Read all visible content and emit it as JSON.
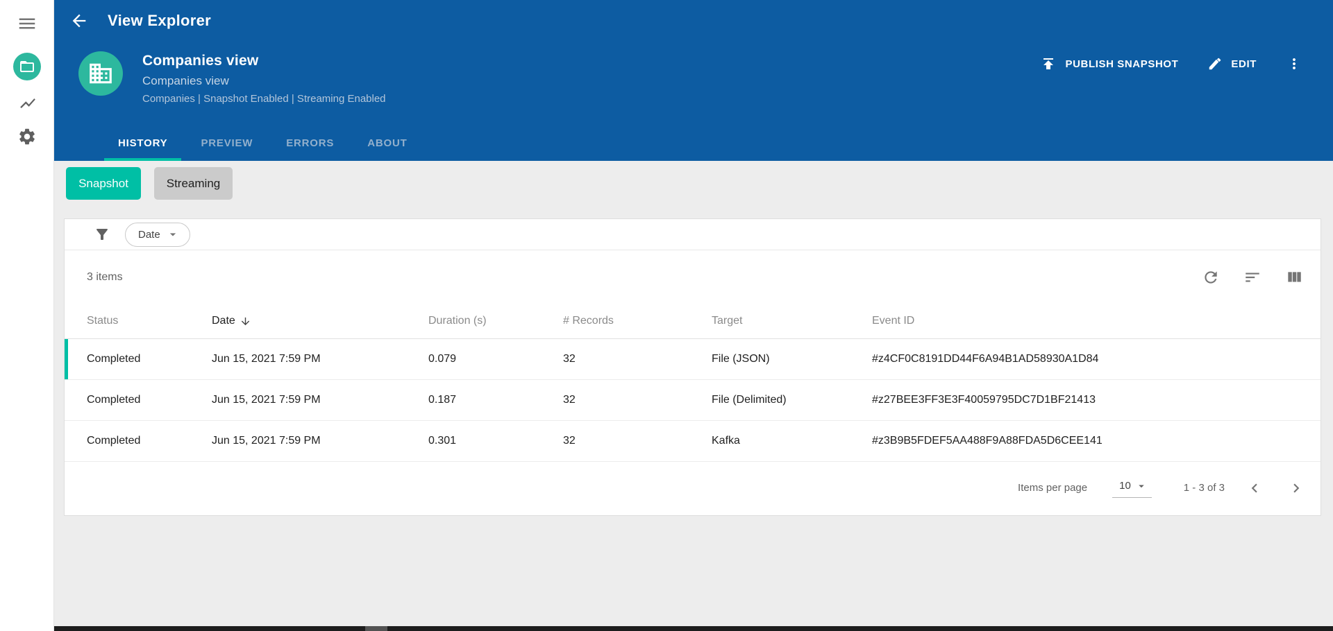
{
  "colors": {
    "header_blue": "#0d5ca2",
    "accent_teal": "#00bfa5",
    "avatar_teal": "#2db89e",
    "inactive_tab": "#93b0cc"
  },
  "sidebar": {
    "icons": [
      "menu-icon",
      "app-folder-icon",
      "chart-icon",
      "gear-icon"
    ]
  },
  "appbar": {
    "title": "View Explorer"
  },
  "view_header": {
    "title": "Companies view",
    "subtitle": "Companies view",
    "meta": "Companies | Snapshot Enabled | Streaming Enabled",
    "publish_label": "PUBLISH SNAPSHOT",
    "edit_label": "EDIT"
  },
  "tabs": [
    {
      "label": "HISTORY",
      "active": true
    },
    {
      "label": "PREVIEW",
      "active": false
    },
    {
      "label": "ERRORS",
      "active": false
    },
    {
      "label": "ABOUT",
      "active": false
    }
  ],
  "mode_toggle": {
    "snapshot_label": "Snapshot",
    "streaming_label": "Streaming",
    "active": "Snapshot"
  },
  "filter_bar": {
    "chip_label": "Date"
  },
  "list_header": {
    "items_count": "3 items"
  },
  "table": {
    "columns": [
      {
        "label": "Status"
      },
      {
        "label": "Date",
        "sorted": "desc"
      },
      {
        "label": "Duration (s)"
      },
      {
        "label": "# Records"
      },
      {
        "label": "Target"
      },
      {
        "label": "Event ID"
      }
    ],
    "rows": [
      {
        "status": "Completed",
        "date": "Jun 15, 2021 7:59 PM",
        "duration": "0.079",
        "records": "32",
        "target": "File (JSON)",
        "event_id": "#z4CF0C8191DD44F6A94B1AD58930A1D84",
        "highlighted": true
      },
      {
        "status": "Completed",
        "date": "Jun 15, 2021 7:59 PM",
        "duration": "0.187",
        "records": "32",
        "target": "File (Delimited)",
        "event_id": "#z27BEE3FF3E3F40059795DC7D1BF21413",
        "highlighted": false
      },
      {
        "status": "Completed",
        "date": "Jun 15, 2021 7:59 PM",
        "duration": "0.301",
        "records": "32",
        "target": "Kafka",
        "event_id": "#z3B9B5FDEF5AA488F9A88FDA5D6CEE141",
        "highlighted": false
      }
    ]
  },
  "pagination": {
    "items_per_page_label": "Items per page",
    "page_size": "10",
    "range_label": "1 - 3 of 3"
  }
}
